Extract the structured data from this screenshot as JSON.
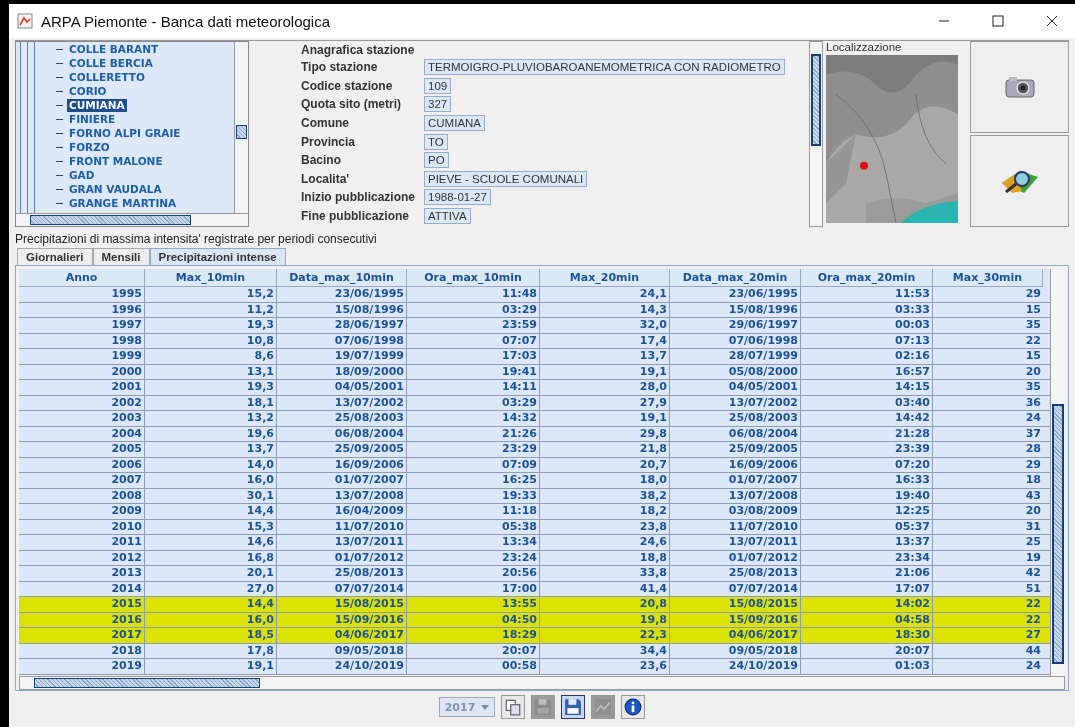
{
  "window": {
    "title": "ARPA Piemonte - Banca dati meteorologica"
  },
  "station_tree": {
    "items": [
      {
        "label": "COLLE BARANT",
        "selected": false
      },
      {
        "label": "COLLE BERCIA",
        "selected": false
      },
      {
        "label": "COLLERETTO",
        "selected": false
      },
      {
        "label": "CORIO",
        "selected": false
      },
      {
        "label": "CUMIANA",
        "selected": true
      },
      {
        "label": "FINIERE",
        "selected": false
      },
      {
        "label": "FORNO ALPI GRAIE",
        "selected": false
      },
      {
        "label": "FORZO",
        "selected": false
      },
      {
        "label": "FRONT MALONE",
        "selected": false
      },
      {
        "label": "GAD",
        "selected": false
      },
      {
        "label": "GRAN VAUDALA",
        "selected": false
      },
      {
        "label": "GRANGE MARTINA",
        "selected": false
      }
    ]
  },
  "station_info": {
    "heading": "Anagrafica stazione",
    "fields": [
      {
        "label": "Tipo stazione",
        "value": "TERMOIGRO-PLUVIOBAROANEMOMETRICA CON RADIOMETRO"
      },
      {
        "label": "Codice stazione",
        "value": "109"
      },
      {
        "label": "Quota sito (metri)",
        "value": "327"
      },
      {
        "label": "Comune",
        "value": "CUMIANA"
      },
      {
        "label": "Provincia",
        "value": "TO"
      },
      {
        "label": "Bacino",
        "value": "PO"
      },
      {
        "label": "Localita'",
        "value": "PIEVE - SCUOLE COMUNALI"
      },
      {
        "label": "Inizio pubblicazione",
        "value": "1988-01-27"
      },
      {
        "label": "Fine pubblicazione",
        "value": "ATTIVA"
      }
    ]
  },
  "location": {
    "label": "Localizzazione"
  },
  "section_title": "Precipitazioni di massima intensita' registrate per periodi consecutivi",
  "tabs": [
    {
      "label": "Giornalieri",
      "selected": false
    },
    {
      "label": "Mensili",
      "selected": false
    },
    {
      "label": "Precipitazioni intense",
      "selected": true
    }
  ],
  "table": {
    "columns": [
      "Anno",
      "Max_10min",
      "Data_max_10min",
      "Ora_max_10min",
      "Max_20min",
      "Data_max_20min",
      "Ora_max_20min",
      "Max_30min"
    ],
    "rows": [
      {
        "cells": [
          "1995",
          "15,2",
          "23/06/1995",
          "11:48",
          "24,1",
          "23/06/1995",
          "11:53",
          "29"
        ],
        "highlighted": false
      },
      {
        "cells": [
          "1996",
          "11,2",
          "15/08/1996",
          "03:29",
          "14,3",
          "15/08/1996",
          "03:33",
          "15"
        ],
        "highlighted": false
      },
      {
        "cells": [
          "1997",
          "19,3",
          "28/06/1997",
          "23:59",
          "32,0",
          "29/06/1997",
          "00:03",
          "35"
        ],
        "highlighted": false
      },
      {
        "cells": [
          "1998",
          "10,8",
          "07/06/1998",
          "07:07",
          "17,4",
          "07/06/1998",
          "07:13",
          "22"
        ],
        "highlighted": false
      },
      {
        "cells": [
          "1999",
          "8,6",
          "19/07/1999",
          "17:03",
          "13,7",
          "28/07/1999",
          "02:16",
          "15"
        ],
        "highlighted": false
      },
      {
        "cells": [
          "2000",
          "13,1",
          "18/09/2000",
          "19:41",
          "19,1",
          "05/08/2000",
          "16:57",
          "20"
        ],
        "highlighted": false
      },
      {
        "cells": [
          "2001",
          "19,3",
          "04/05/2001",
          "14:11",
          "28,0",
          "04/05/2001",
          "14:15",
          "35"
        ],
        "highlighted": false
      },
      {
        "cells": [
          "2002",
          "18,1",
          "13/07/2002",
          "03:29",
          "27,9",
          "13/07/2002",
          "03:40",
          "36"
        ],
        "highlighted": false
      },
      {
        "cells": [
          "2003",
          "13,2",
          "25/08/2003",
          "14:32",
          "19,1",
          "25/08/2003",
          "14:42",
          "24"
        ],
        "highlighted": false
      },
      {
        "cells": [
          "2004",
          "19,6",
          "06/08/2004",
          "21:26",
          "29,8",
          "06/08/2004",
          "21:28",
          "37"
        ],
        "highlighted": false
      },
      {
        "cells": [
          "2005",
          "13,7",
          "25/09/2005",
          "23:29",
          "21,8",
          "25/09/2005",
          "23:39",
          "28"
        ],
        "highlighted": false
      },
      {
        "cells": [
          "2006",
          "14,0",
          "16/09/2006",
          "07:09",
          "20,7",
          "16/09/2006",
          "07:20",
          "29"
        ],
        "highlighted": false
      },
      {
        "cells": [
          "2007",
          "16,0",
          "01/07/2007",
          "16:25",
          "18,0",
          "01/07/2007",
          "16:33",
          "18"
        ],
        "highlighted": false
      },
      {
        "cells": [
          "2008",
          "30,1",
          "13/07/2008",
          "19:33",
          "38,2",
          "13/07/2008",
          "19:40",
          "43"
        ],
        "highlighted": false
      },
      {
        "cells": [
          "2009",
          "14,4",
          "16/04/2009",
          "11:18",
          "18,2",
          "03/08/2009",
          "12:25",
          "20"
        ],
        "highlighted": false
      },
      {
        "cells": [
          "2010",
          "15,3",
          "11/07/2010",
          "05:38",
          "23,8",
          "11/07/2010",
          "05:37",
          "31"
        ],
        "highlighted": false
      },
      {
        "cells": [
          "2011",
          "14,6",
          "13/07/2011",
          "13:34",
          "24,6",
          "13/07/2011",
          "13:37",
          "25"
        ],
        "highlighted": false
      },
      {
        "cells": [
          "2012",
          "16,8",
          "01/07/2012",
          "23:24",
          "18,8",
          "01/07/2012",
          "23:34",
          "19"
        ],
        "highlighted": false
      },
      {
        "cells": [
          "2013",
          "20,1",
          "25/08/2013",
          "20:56",
          "33,8",
          "25/08/2013",
          "21:06",
          "42"
        ],
        "highlighted": false
      },
      {
        "cells": [
          "2014",
          "27,0",
          "07/07/2014",
          "17:00",
          "41,4",
          "07/07/2014",
          "17:07",
          "51"
        ],
        "highlighted": false
      },
      {
        "cells": [
          "2015",
          "14,4",
          "15/08/2015",
          "13:55",
          "20,8",
          "15/08/2015",
          "14:02",
          "22"
        ],
        "highlighted": true
      },
      {
        "cells": [
          "2016",
          "16,0",
          "15/09/2016",
          "04:50",
          "19,8",
          "15/09/2016",
          "04:58",
          "22"
        ],
        "highlighted": true
      },
      {
        "cells": [
          "2017",
          "18,5",
          "04/06/2017",
          "18:29",
          "22,3",
          "04/06/2017",
          "18:30",
          "27"
        ],
        "highlighted": true
      },
      {
        "cells": [
          "2018",
          "17,8",
          "09/05/2018",
          "20:07",
          "34,4",
          "09/05/2018",
          "20:07",
          "44"
        ],
        "highlighted": false
      },
      {
        "cells": [
          "2019",
          "19,1",
          "24/10/2019",
          "00:58",
          "23,6",
          "24/10/2019",
          "01:03",
          "24"
        ],
        "highlighted": false
      }
    ]
  },
  "toolbar": {
    "year": "2017"
  }
}
